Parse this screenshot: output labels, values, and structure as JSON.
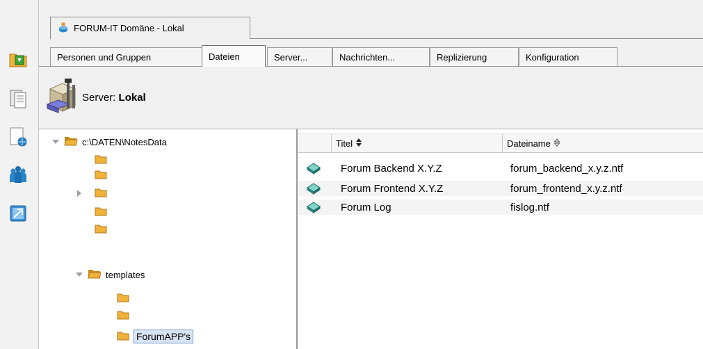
{
  "window_tab": {
    "label": "FORUM-IT Domäne - Lokal"
  },
  "nav_tabs": [
    {
      "label": "Personen und Gruppen"
    },
    {
      "label": "Dateien"
    },
    {
      "label": "Server..."
    },
    {
      "label": "Nachrichten..."
    },
    {
      "label": "Replizierung"
    },
    {
      "label": "Konfiguration"
    }
  ],
  "server": {
    "prefix": "Server:",
    "name": "Lokal"
  },
  "tree": {
    "root": "c:\\DATEN\\NotesData",
    "templates": "templates",
    "selected": "ForumAPP's"
  },
  "list": {
    "columns": {
      "title": "Titel",
      "filename": "Dateiname"
    },
    "rows": [
      {
        "title": "Forum Backend X.Y.Z",
        "filename": "forum_backend_x.y.z.ntf"
      },
      {
        "title": "Forum Frontend X.Y.Z",
        "filename": "forum_frontend_x.y.z.ntf"
      },
      {
        "title": "Forum Log",
        "filename": "fislog.ntf"
      }
    ]
  },
  "icons": {
    "left_strip": [
      "folder-arrow-icon",
      "document-pages-icon",
      "network-document-icon",
      "people-icon",
      "tools-icon"
    ],
    "tab": "database-person-icon",
    "server": "server-tools-icon",
    "row": "template-book-icon"
  },
  "colors": {
    "folder": "#f0b23a",
    "folder_dark": "#c98a1c",
    "accent_blue": "#2a86c9",
    "selection_bg": "#d6e4f5"
  }
}
